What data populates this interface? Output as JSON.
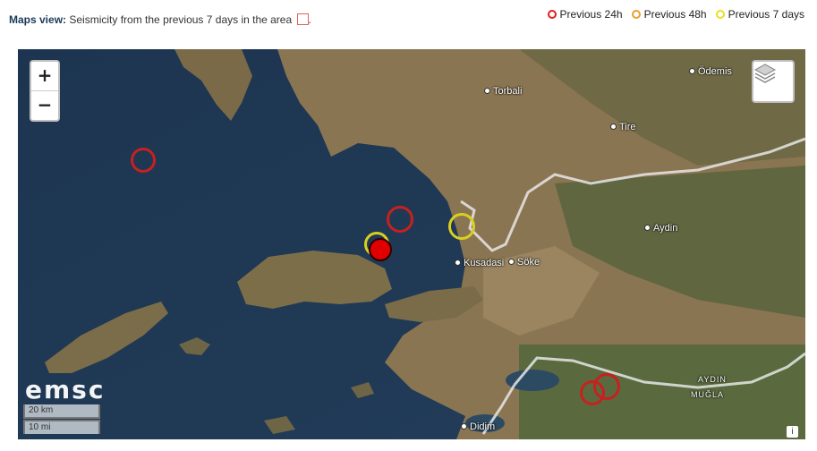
{
  "header": {
    "label": "Maps view:",
    "text": "Seismicity from the previous 7 days in the area",
    "suffix": "."
  },
  "legend": [
    {
      "label": "Previous 24h",
      "color": "#e02020"
    },
    {
      "label": "Previous 48h",
      "color": "#e8a030"
    },
    {
      "label": "Previous 7 days",
      "color": "#e8e020"
    }
  ],
  "map": {
    "zoom_in": "+",
    "zoom_out": "−",
    "logo": "emsc",
    "scale_km": "20 km",
    "scale_mi": "10 mi",
    "attribution": "i",
    "places": [
      {
        "name": "Ödemis"
      },
      {
        "name": "Torbali"
      },
      {
        "name": "Tire"
      },
      {
        "name": "Aydin"
      },
      {
        "name": "Kusadasi"
      },
      {
        "name": "Söke"
      },
      {
        "name": "Didim"
      }
    ],
    "regions": [
      "AYDIN",
      "MUĞLA"
    ],
    "icons": {
      "layers": "layers-icon"
    }
  }
}
